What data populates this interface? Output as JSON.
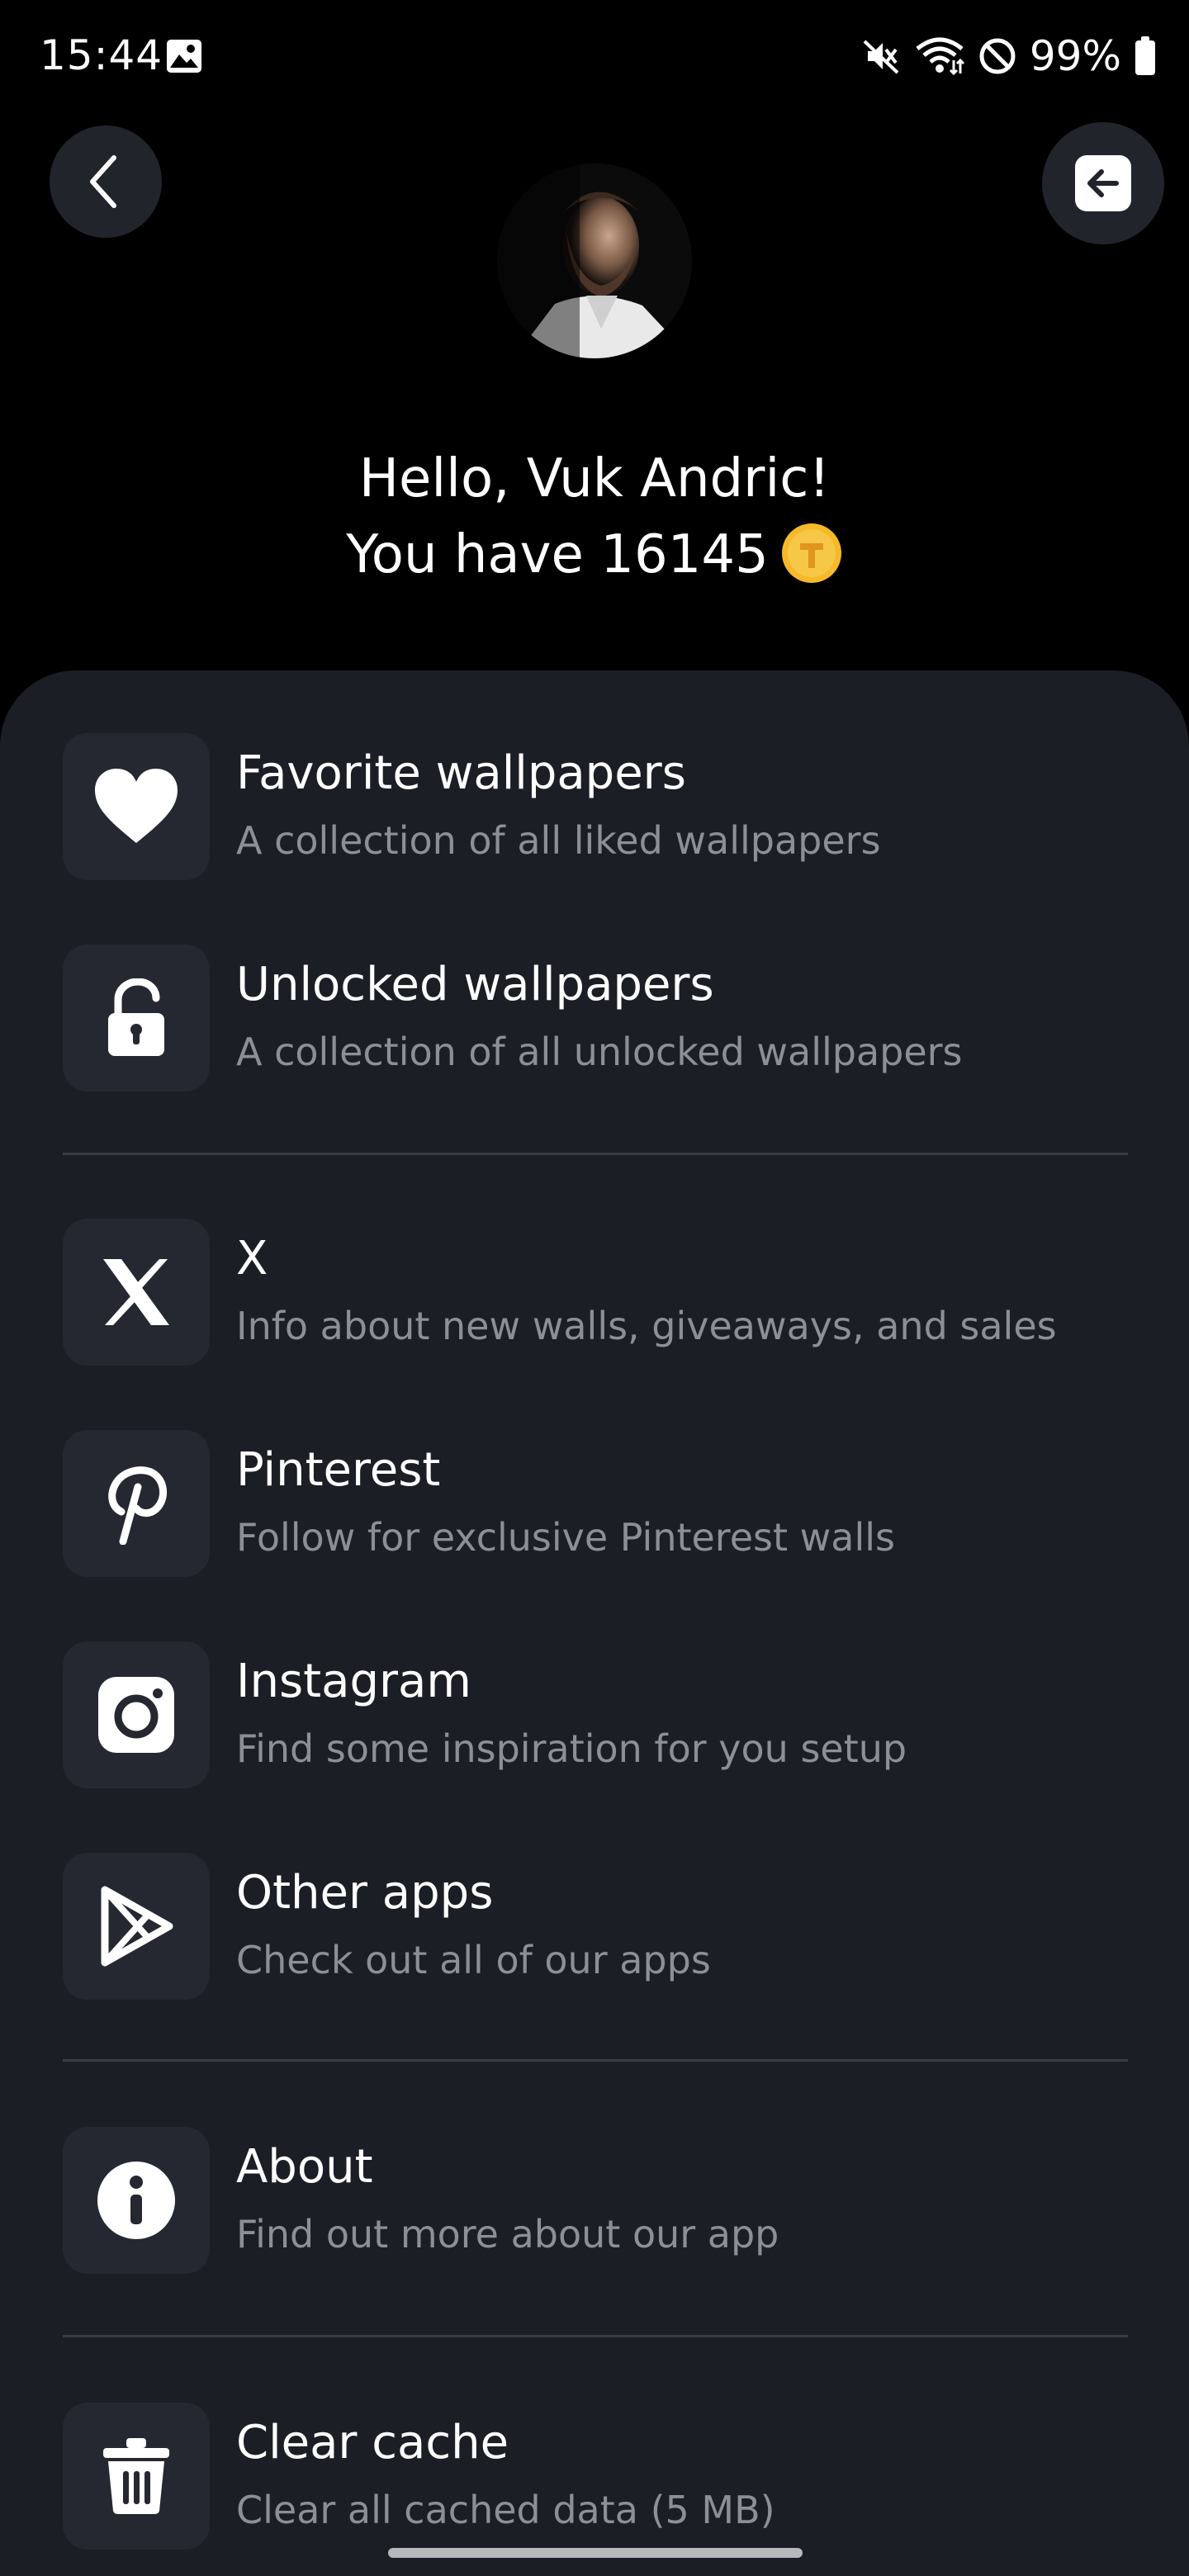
{
  "status_bar": {
    "time": "15:44",
    "battery_text": "99%",
    "icons": [
      "gallery-icon",
      "mute-icon",
      "wifi-icon",
      "dnd-icon",
      "battery-icon"
    ]
  },
  "header": {
    "greeting": "Hello, Vuk Andric!",
    "coins_prefix": "You have 16145",
    "coin_icon": "coin-icon",
    "coin_color": "#f5b92a"
  },
  "menu": {
    "items": [
      {
        "title": "Favorite wallpapers",
        "subtitle": "A collection of all liked wallpapers",
        "icon": "heart-icon"
      },
      {
        "title": "Unlocked wallpapers",
        "subtitle": "A collection of all unlocked wallpapers",
        "icon": "unlock-icon"
      },
      {
        "title": "X",
        "subtitle": "Info about new walls, giveaways, and sales",
        "icon": "x-logo-icon"
      },
      {
        "title": "Pinterest",
        "subtitle": "Follow for exclusive Pinterest walls",
        "icon": "pinterest-icon"
      },
      {
        "title": "Instagram",
        "subtitle": "Find some inspiration for you setup",
        "icon": "instagram-icon"
      },
      {
        "title": "Other apps",
        "subtitle": "Check out all of our apps",
        "icon": "play-store-icon"
      },
      {
        "title": "About",
        "subtitle": "Find out more about our app",
        "icon": "info-icon"
      },
      {
        "title": "Clear cache",
        "subtitle": "Clear all cached data (5 MB)",
        "icon": "trash-icon"
      }
    ]
  },
  "colors": {
    "background": "#000000",
    "sheet": "#1c1e26",
    "icon_tile": "#262831",
    "subtitle": "#8d8f96"
  }
}
